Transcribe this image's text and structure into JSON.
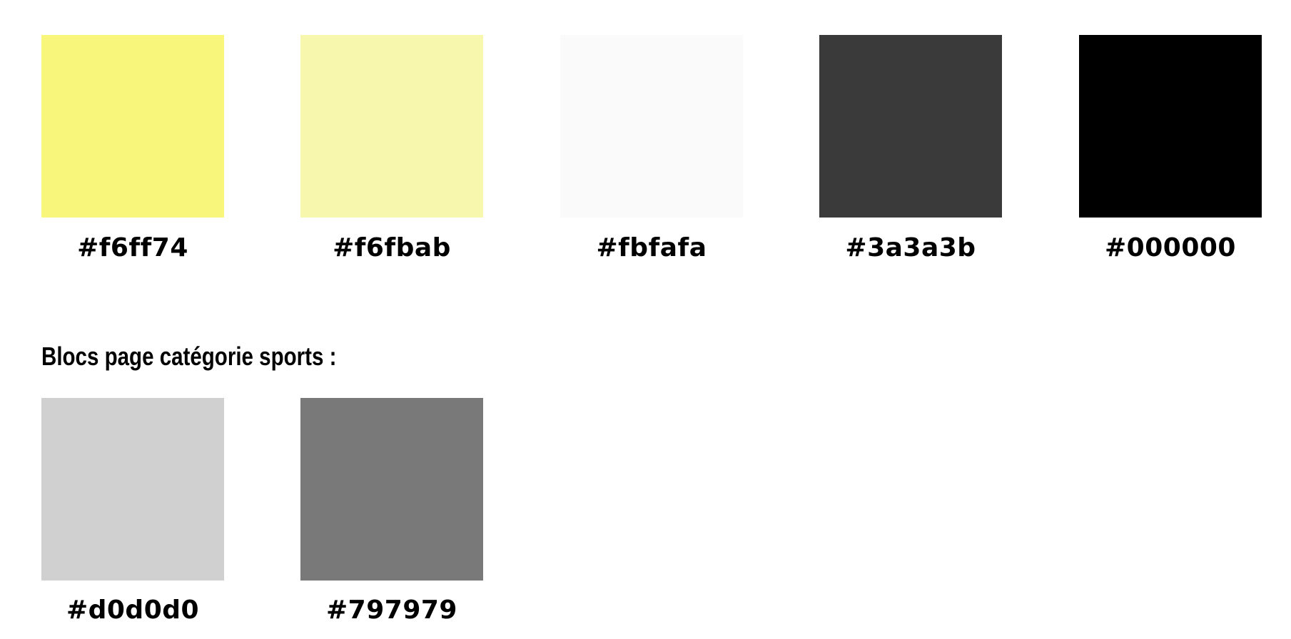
{
  "palette_top": [
    {
      "label": "#f6ff74",
      "color": "#f8f77c"
    },
    {
      "label": "#f6fbab",
      "color": "#f7f7ad"
    },
    {
      "label": "#fbfafa",
      "color": "#fafafa"
    },
    {
      "label": "#3a3a3b",
      "color": "#3a3a3b"
    },
    {
      "label": "#000000",
      "color": "#000000"
    }
  ],
  "section": {
    "title": "Blocs page catégorie sports :"
  },
  "palette_sports": [
    {
      "label": "#d0d0d0",
      "color": "#d0d0d0"
    },
    {
      "label": "#797979",
      "color": "#797979"
    }
  ]
}
